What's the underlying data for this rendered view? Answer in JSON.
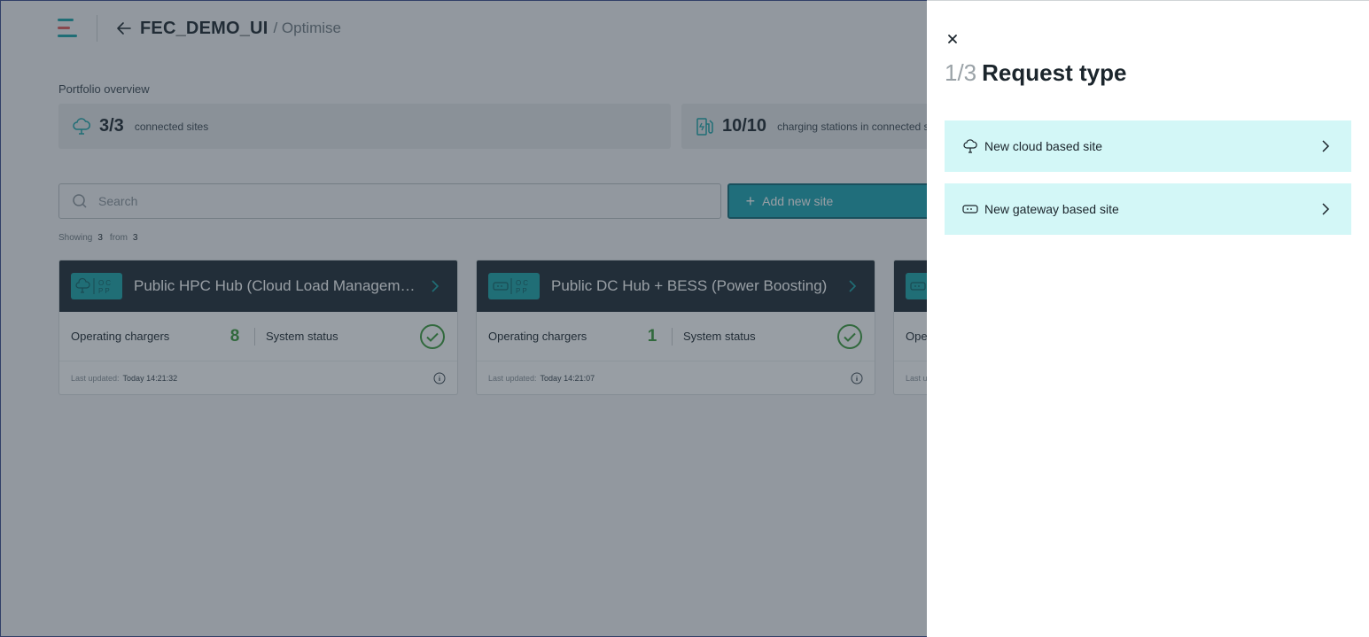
{
  "header": {
    "title": "FEC_DEMO_UI",
    "breadcrumb": "/ Optimise"
  },
  "portfolio": {
    "label": "Portfolio overview",
    "connected_sites": {
      "value": "3/3",
      "label": "connected sites"
    },
    "charging_stations": {
      "value": "10/10",
      "label": "charging stations in connected sit"
    }
  },
  "search": {
    "placeholder": "Search"
  },
  "add_button": {
    "label": "Add new site"
  },
  "showing": {
    "label": "Showing",
    "count": "3",
    "from_label": "from",
    "total": "3"
  },
  "cards": [
    {
      "name": "Public HPC Hub (Cloud Load Manageme...",
      "badge": "OCPP",
      "operating_label": "Operating chargers",
      "operating_count": "8",
      "status_label": "System status",
      "updated_label": "Last updated:",
      "updated_value": "Today 14:21:32"
    },
    {
      "name": "Public DC Hub + BESS (Power Boosting)",
      "badge": "OCPP",
      "operating_label": "Operating chargers",
      "operating_count": "1",
      "status_label": "System status",
      "updated_label": "Last updated:",
      "updated_value": "Today 14:21:07"
    },
    {
      "operating_label": "Ope",
      "updated_label": "Last u"
    }
  ],
  "drawer": {
    "step": "1/3",
    "title": "Request type",
    "options": [
      {
        "label": "New cloud based site",
        "icon": "cloud-icon"
      },
      {
        "label": "New gateway based site",
        "icon": "gateway-icon"
      }
    ]
  },
  "colors": {
    "accent": "#1aa3a8",
    "option_bg": "#d3f7f7",
    "card_header": "#1d2a33",
    "success": "#3a9a3a"
  }
}
